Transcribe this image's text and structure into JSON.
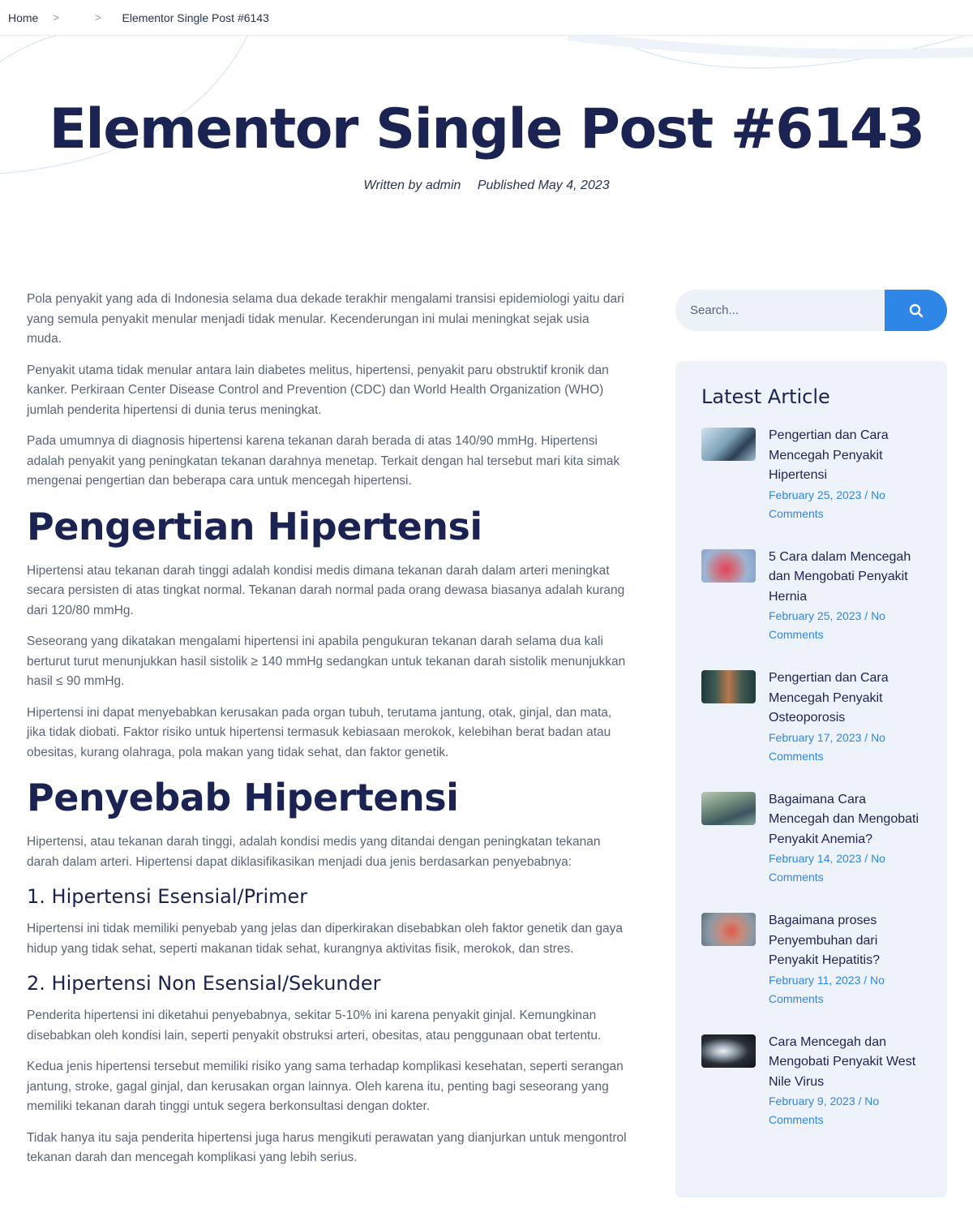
{
  "breadcrumb": {
    "home": "Home",
    "current": "Elementor Single Post #6143"
  },
  "hero": {
    "title": "Elementor Single Post #6143",
    "author": "Written by admin",
    "published": "Published May 4, 2023"
  },
  "article": {
    "intro": [
      "Pola penyakit yang ada di Indonesia selama dua dekade terakhir mengalami transisi epidemiologi yaitu dari yang semula penyakit menular menjadi tidak menular. Kecenderungan ini mulai meningkat sejak usia muda.",
      "Penyakit utama tidak menular antara lain diabetes melitus, hipertensi, penyakit paru obstruktif kronik dan kanker. Perkiraan Center Disease Control and Prevention (CDC) dan World Health Organization (WHO) jumlah penderita hipertensi di dunia terus meningkat.",
      "Pada umumnya di diagnosis hipertensi karena tekanan darah berada di atas 140/90 mmHg. Hipertensi adalah penyakit yang peningkatan tekanan darahnya menetap. Terkait dengan hal tersebut mari kita simak mengenai pengertian dan beberapa cara untuk mencegah hipertensi."
    ],
    "h2_pengertian": "Pengertian Hipertensi",
    "pengertian": [
      "Hipertensi atau tekanan darah tinggi adalah kondisi medis dimana tekanan darah dalam arteri meningkat secara persisten di atas tingkat normal. Tekanan darah normal pada orang dewasa biasanya adalah kurang dari 120/80 mmHg.",
      "Seseorang yang dikatakan mengalami hipertensi ini apabila pengukuran tekanan darah selama dua kali berturut turut menunjukkan hasil sistolik ≥ 140 mmHg sedangkan untuk tekanan darah sistolik menunjukkan hasil ≤ 90 mmHg.",
      "Hipertensi ini dapat menyebabkan kerusakan pada organ tubuh, terutama jantung, otak, ginjal, dan mata, jika tidak diobati. Faktor risiko untuk hipertensi termasuk kebiasaan merokok, kelebihan berat badan atau obesitas, kurang olahraga, pola makan yang tidak sehat, dan faktor genetik."
    ],
    "h2_penyebab": "Penyebab Hipertensi",
    "penyebab_intro": "Hipertensi, atau tekanan darah tinggi, adalah kondisi medis yang ditandai dengan peningkatan tekanan darah dalam arteri. Hipertensi dapat diklasifikasikan menjadi dua jenis berdasarkan penyebabnya:",
    "h3_primer": "1. Hipertensi Esensial/Primer",
    "primer": "Hipertensi ini tidak memiliki penyebab yang jelas dan diperkirakan disebabkan oleh faktor genetik dan gaya hidup yang tidak sehat, seperti makanan tidak sehat, kurangnya aktivitas fisik, merokok, dan stres.",
    "h3_sekunder": "2. Hipertensi Non Esensial/Sekunder",
    "sekunder": "Penderita hipertensi ini diketahui penyebabnya, sekitar 5-10% ini karena penyakit ginjal. Kemungkinan disebabkan oleh kondisi lain, seperti penyakit obstruksi arteri, obesitas, atau penggunaan obat tertentu.",
    "kedua": "Kedua jenis hipertensi tersebut memiliki risiko yang sama terhadap komplikasi kesehatan, seperti serangan jantung, stroke, gagal ginjal, dan kerusakan organ lainnya. Oleh karena itu, penting bagi seseorang yang memiliki tekanan darah tinggi untuk segera berkonsultasi dengan dokter.",
    "tidak_hanya": "Tidak hanya itu saja penderita hipertensi juga harus mengikuti perawatan yang dianjurkan untuk mengontrol tekanan darah dan mencegah komplikasi yang lebih serius."
  },
  "sidebar": {
    "search_placeholder": "Search...",
    "latest_title": "Latest Article",
    "articles": [
      {
        "title": "Pengertian dan Cara Mencegah Penyakit Hipertensi",
        "meta": "February 25, 2023 / No Comments"
      },
      {
        "title": "5 Cara dalam Mencegah dan Mengobati Penyakit Hernia",
        "meta": "February 25, 2023 / No Comments"
      },
      {
        "title": "Pengertian dan Cara Mencegah Penyakit Osteoporosis",
        "meta": "February 17, 2023 / No Comments"
      },
      {
        "title": "Bagaimana Cara Mencegah dan Mengobati Penyakit Anemia?",
        "meta": "February 14, 2023 / No Comments"
      },
      {
        "title": "Bagaimana proses Penyembuhan dari Penyakit Hepatitis?",
        "meta": "February 11, 2023 / No Comments"
      },
      {
        "title": "Cara Mencegah dan Mengobati Penyakit West Nile Virus",
        "meta": "February 9, 2023 / No Comments"
      }
    ]
  },
  "colors": {
    "heading": "#1b2353",
    "body_text": "#5a6478",
    "accent": "#2e86e6",
    "sidebar_bg": "#eef2fb"
  }
}
